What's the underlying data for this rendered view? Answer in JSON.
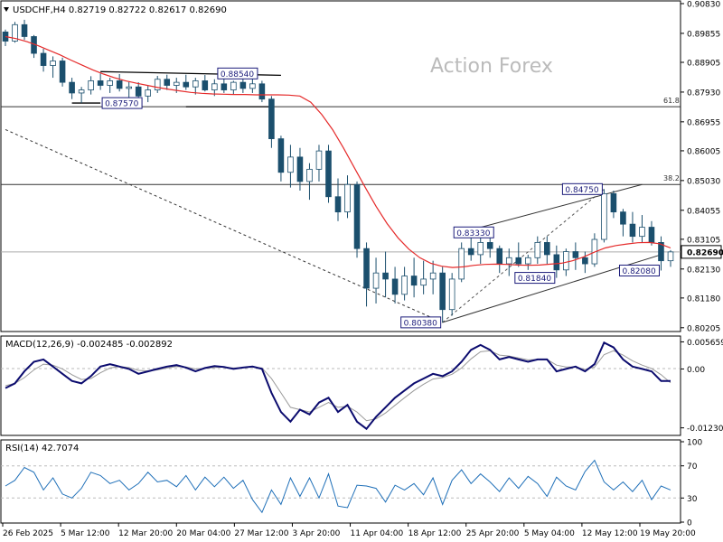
{
  "header": {
    "symbol_line": "USDCHF,H4  0.82719 0.82722 0.82617 0.82690"
  },
  "watermark": "Action Forex",
  "chart_data": [
    {
      "type": "candlestick",
      "name": "price",
      "ylim": [
        0.8011,
        0.9083
      ],
      "y_ticks": [
        "0.90830",
        "0.89855",
        "0.88905",
        "0.87930",
        "0.86955",
        "0.86005",
        "0.85030",
        "0.84055",
        "0.83105",
        "0.82130",
        "0.81180",
        "0.80205"
      ],
      "current_price": "0.82690",
      "moving_average": [
        0.8975,
        0.8968,
        0.8958,
        0.8945,
        0.893,
        0.8915,
        0.8898,
        0.8882,
        0.8866,
        0.8852,
        0.884,
        0.883,
        0.8822,
        0.8815,
        0.8808,
        0.8802,
        0.8797,
        0.8792,
        0.8789,
        0.8787,
        0.8786,
        0.8785,
        0.8785,
        0.8784,
        0.8784,
        0.8784,
        0.8783,
        0.878,
        0.876,
        0.872,
        0.867,
        0.861,
        0.8545,
        0.848,
        0.8418,
        0.8362,
        0.8315,
        0.8278,
        0.825,
        0.8232,
        0.8222,
        0.8218,
        0.822,
        0.8225,
        0.8228,
        0.8229,
        0.8228,
        0.8226,
        0.8225,
        0.8226,
        0.8229,
        0.8232,
        0.824,
        0.8252,
        0.8268,
        0.8282,
        0.829,
        0.8295,
        0.8299,
        0.83,
        0.8296,
        0.8282
      ],
      "ohlc": [
        [
          0.899,
          0.8998,
          0.8944,
          0.896
        ],
        [
          0.896,
          0.9023,
          0.8955,
          0.9014
        ],
        [
          0.9014,
          0.903,
          0.8964,
          0.8975
        ],
        [
          0.8975,
          0.898,
          0.8905,
          0.892
        ],
        [
          0.892,
          0.8935,
          0.886,
          0.888
        ],
        [
          0.888,
          0.891,
          0.884,
          0.8895
        ],
        [
          0.8895,
          0.8906,
          0.8811,
          0.8825
        ],
        [
          0.8825,
          0.884,
          0.877,
          0.879
        ],
        [
          0.879,
          0.881,
          0.8757,
          0.88
        ],
        [
          0.88,
          0.8845,
          0.8785,
          0.883
        ],
        [
          0.883,
          0.8854,
          0.88,
          0.8815
        ],
        [
          0.8815,
          0.884,
          0.879,
          0.883
        ],
        [
          0.883,
          0.8852,
          0.8795,
          0.8805
        ],
        [
          0.8805,
          0.8826,
          0.8775,
          0.881
        ],
        [
          0.881,
          0.8825,
          0.8766,
          0.878
        ],
        [
          0.878,
          0.8815,
          0.876,
          0.88
        ],
        [
          0.88,
          0.8846,
          0.879,
          0.8835
        ],
        [
          0.8835,
          0.885,
          0.88,
          0.8815
        ],
        [
          0.8815,
          0.884,
          0.879,
          0.8825
        ],
        [
          0.8825,
          0.885,
          0.88,
          0.881
        ],
        [
          0.881,
          0.884,
          0.8785,
          0.883
        ],
        [
          0.883,
          0.8849,
          0.8795,
          0.88
        ],
        [
          0.88,
          0.8835,
          0.878,
          0.882
        ],
        [
          0.882,
          0.8844,
          0.879,
          0.88
        ],
        [
          0.88,
          0.883,
          0.8785,
          0.8825
        ],
        [
          0.8825,
          0.8846,
          0.879,
          0.8805
        ],
        [
          0.8805,
          0.8838,
          0.879,
          0.882
        ],
        [
          0.882,
          0.883,
          0.876,
          0.877
        ],
        [
          0.877,
          0.878,
          0.861,
          0.864
        ],
        [
          0.864,
          0.865,
          0.85,
          0.853
        ],
        [
          0.853,
          0.862,
          0.848,
          0.858
        ],
        [
          0.858,
          0.861,
          0.847,
          0.85
        ],
        [
          0.85,
          0.856,
          0.844,
          0.854
        ],
        [
          0.854,
          0.862,
          0.85,
          0.86
        ],
        [
          0.86,
          0.862,
          0.843,
          0.845
        ],
        [
          0.845,
          0.851,
          0.837,
          0.84
        ],
        [
          0.84,
          0.852,
          0.838,
          0.849
        ],
        [
          0.849,
          0.85,
          0.825,
          0.828
        ],
        [
          0.828,
          0.83,
          0.809,
          0.815
        ],
        [
          0.815,
          0.825,
          0.81,
          0.82
        ],
        [
          0.82,
          0.827,
          0.812,
          0.818
        ],
        [
          0.818,
          0.822,
          0.81,
          0.813
        ],
        [
          0.813,
          0.822,
          0.811,
          0.819
        ],
        [
          0.819,
          0.825,
          0.812,
          0.816
        ],
        [
          0.816,
          0.824,
          0.813,
          0.818
        ],
        [
          0.818,
          0.824,
          0.813,
          0.82
        ],
        [
          0.82,
          0.822,
          0.8038,
          0.808
        ],
        [
          0.808,
          0.82,
          0.806,
          0.818
        ],
        [
          0.818,
          0.83,
          0.817,
          0.828
        ],
        [
          0.828,
          0.8333,
          0.824,
          0.826
        ],
        [
          0.826,
          0.832,
          0.823,
          0.83
        ],
        [
          0.83,
          0.833,
          0.825,
          0.828
        ],
        [
          0.828,
          0.829,
          0.82,
          0.823
        ],
        [
          0.823,
          0.828,
          0.819,
          0.825
        ],
        [
          0.825,
          0.83,
          0.822,
          0.823
        ],
        [
          0.823,
          0.826,
          0.821,
          0.825
        ],
        [
          0.825,
          0.832,
          0.823,
          0.83
        ],
        [
          0.83,
          0.832,
          0.823,
          0.826
        ],
        [
          0.826,
          0.829,
          0.8184,
          0.821
        ],
        [
          0.821,
          0.828,
          0.819,
          0.827
        ],
        [
          0.827,
          0.83,
          0.821,
          0.825
        ],
        [
          0.825,
          0.827,
          0.82,
          0.823
        ],
        [
          0.823,
          0.833,
          0.822,
          0.831
        ],
        [
          0.831,
          0.8475,
          0.83,
          0.846
        ],
        [
          0.846,
          0.847,
          0.838,
          0.84
        ],
        [
          0.84,
          0.841,
          0.832,
          0.836
        ],
        [
          0.836,
          0.84,
          0.83,
          0.832
        ],
        [
          0.832,
          0.839,
          0.83,
          0.835
        ],
        [
          0.835,
          0.837,
          0.829,
          0.83
        ],
        [
          0.83,
          0.832,
          0.8208,
          0.824
        ],
        [
          0.824,
          0.8275,
          0.822,
          0.8269
        ]
      ],
      "annotations": {
        "horizontal_lines": [
          {
            "value": 0.8745,
            "label": "61.8"
          },
          {
            "value": 0.849,
            "label": "38.2"
          }
        ],
        "price_labels": [
          {
            "text": "0.88540",
            "value": 0.8854
          },
          {
            "text": "0.87570",
            "value": 0.8757
          },
          {
            "text": "0.83330",
            "value": 0.8333
          },
          {
            "text": "0.84750",
            "value": 0.8475
          },
          {
            "text": "0.81840",
            "value": 0.8184
          },
          {
            "text": "0.82080",
            "value": 0.8208
          },
          {
            "text": "0.80380",
            "value": 0.8038
          }
        ]
      }
    },
    {
      "type": "line",
      "name": "MACD",
      "label": "MACD(12,26,9) -0.002485 -0.002892",
      "ylim": [
        -0.0135,
        0.0065
      ],
      "y_ticks": [
        "0.005659",
        "0.00",
        "-0.012301"
      ],
      "macd": [
        -0.004,
        -0.003,
        -0.0005,
        0.0015,
        0.002,
        0.0005,
        -0.001,
        -0.0025,
        -0.003,
        -0.0015,
        0.0005,
        0.001,
        0.0005,
        0.0,
        -0.001,
        -0.0005,
        0.0,
        0.0005,
        0.0008,
        0.0003,
        -0.0005,
        0.0002,
        0.0006,
        0.0004,
        0.0,
        0.0003,
        0.0005,
        0.0,
        -0.005,
        -0.009,
        -0.011,
        -0.0085,
        -0.0095,
        -0.007,
        -0.006,
        -0.009,
        -0.0075,
        -0.011,
        -0.0125,
        -0.01,
        -0.008,
        -0.006,
        -0.0045,
        -0.003,
        -0.002,
        -0.001,
        -0.0015,
        -0.0005,
        0.0015,
        0.004,
        0.005,
        0.004,
        0.002,
        0.0025,
        0.002,
        0.0015,
        0.002,
        0.002,
        -0.0005,
        0.0,
        0.0005,
        -0.0005,
        0.001,
        0.0055,
        0.0045,
        0.002,
        0.0005,
        0.0,
        -0.0005,
        -0.0025,
        -0.0025
      ],
      "signal": [
        -0.0035,
        -0.003,
        -0.0018,
        -0.0002,
        0.001,
        0.0008,
        0.0,
        -0.0012,
        -0.0022,
        -0.002,
        -0.0008,
        0.0002,
        0.0005,
        0.0003,
        -0.0003,
        -0.0004,
        -0.0002,
        0.0002,
        0.0005,
        0.0004,
        0.0,
        0.0001,
        0.0003,
        0.0004,
        0.0002,
        0.0003,
        0.0004,
        0.0002,
        -0.002,
        -0.005,
        -0.008,
        -0.0085,
        -0.009,
        -0.008,
        -0.007,
        -0.008,
        -0.0078,
        -0.009,
        -0.0108,
        -0.0104,
        -0.0092,
        -0.0076,
        -0.006,
        -0.0045,
        -0.0032,
        -0.0021,
        -0.0018,
        -0.0011,
        0.0002,
        0.0021,
        0.0036,
        0.0038,
        0.0029,
        0.0027,
        0.0023,
        0.0019,
        0.002,
        0.002,
        0.0008,
        0.0004,
        0.0004,
        -0.0001,
        0.0004,
        0.003,
        0.0038,
        0.0029,
        0.0017,
        0.0008,
        0.0001,
        -0.0012,
        -0.0029
      ]
    },
    {
      "type": "line",
      "name": "RSI",
      "label": "RSI(14) 42.7074",
      "ylim": [
        0,
        100
      ],
      "y_ticks": [
        "100",
        "70",
        "30",
        "0"
      ],
      "levels": [
        70,
        30
      ],
      "values": [
        45,
        52,
        68,
        62,
        40,
        55,
        35,
        30,
        42,
        62,
        58,
        48,
        52,
        40,
        48,
        62,
        50,
        52,
        44,
        58,
        40,
        56,
        44,
        56,
        42,
        52,
        28,
        12,
        40,
        22,
        55,
        32,
        55,
        30,
        60,
        20,
        18,
        46,
        45,
        42,
        25,
        46,
        40,
        48,
        34,
        55,
        22,
        52,
        65,
        48,
        60,
        50,
        38,
        55,
        42,
        57,
        48,
        32,
        56,
        45,
        40,
        63,
        77,
        50,
        40,
        50,
        38,
        52,
        28,
        45,
        40
      ]
    }
  ],
  "x_axis": {
    "labels": [
      "26 Feb 2025",
      "5 Mar 12:00",
      "12 Mar 20:00",
      "20 Mar 04:00",
      "27 Mar 12:00",
      "3 Apr 20:00",
      "11 Apr 04:00",
      "18 Apr 12:00",
      "25 Apr 20:00",
      "5 May 04:00",
      "12 May 12:00",
      "19 May 20:00"
    ]
  },
  "colors": {
    "bull": "#1b4f6d",
    "bear": "#1b4f6d",
    "ma": "#e52a2a",
    "macd": "#0b0b6e",
    "signal": "#9a9a9a",
    "rsi": "#1e6fb8",
    "label_border": "#1b1b7a",
    "watermark": "#bbbbbb"
  }
}
